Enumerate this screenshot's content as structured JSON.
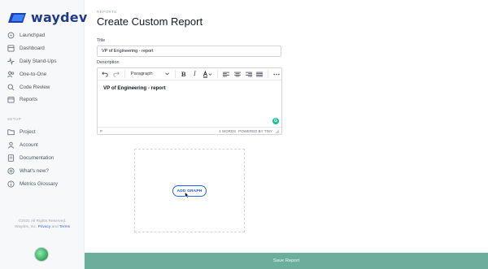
{
  "brand": {
    "name": "waydev"
  },
  "sidebar": {
    "items": [
      {
        "label": "Launchpad",
        "icon": "rocket-icon"
      },
      {
        "label": "Dashboard",
        "icon": "grid-icon"
      },
      {
        "label": "Daily Stand-Ups",
        "icon": "activity-icon"
      },
      {
        "label": "One-to-One",
        "icon": "users-icon"
      },
      {
        "label": "Code Review",
        "icon": "review-icon"
      },
      {
        "label": "Reports",
        "icon": "calendar-icon"
      }
    ],
    "section_label": "SETUP",
    "setup_items": [
      {
        "label": "Project",
        "icon": "folder-icon"
      },
      {
        "label": "Account",
        "icon": "user-icon"
      },
      {
        "label": "Documentation",
        "icon": "document-icon"
      },
      {
        "label": "What's new?",
        "icon": "help-icon"
      },
      {
        "label": "Metrics Glossary",
        "icon": "info-icon"
      }
    ],
    "copyright_line1": "©2021 All Rights Reserved.",
    "copyright_prefix": "Waydev, Inc.",
    "privacy_label": "Privacy",
    "and_label": "and",
    "terms_label": "Terms"
  },
  "main": {
    "breadcrumb": "REPORTS",
    "page_title": "Create Custom Report",
    "title_label": "Title",
    "title_value": "VP of Engineering - report",
    "description_label": "Description",
    "editor": {
      "format_select": "Paragraph",
      "content": "VP of Engineering - report",
      "status_path": "P",
      "word_count": "4 WORDS",
      "powered_by": "POWERED BY TINY"
    },
    "add_graph_label": "ADD GRAPH",
    "save_label": "Save Report"
  },
  "colors": {
    "brand": "#1e3a8a",
    "accent": "#2563eb",
    "save_bar": "#6aae9b"
  }
}
